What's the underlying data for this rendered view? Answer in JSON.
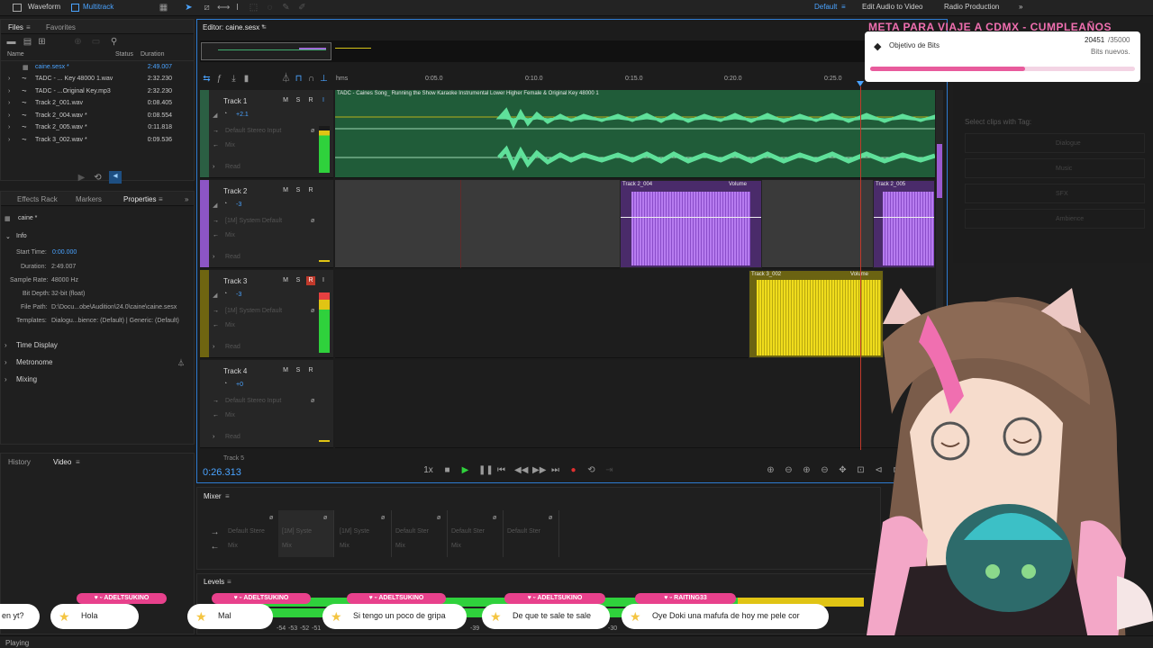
{
  "topbar": {
    "waveform": "Waveform",
    "multitrack": "Multitrack",
    "workspace": "Default",
    "edit_audio_video": "Edit Audio to Video",
    "radio_production": "Radio Production"
  },
  "files_panel": {
    "tabs": [
      "Files",
      "Favorites"
    ],
    "columns": {
      "name": "Name",
      "status": "Status",
      "duration": "Duration"
    },
    "items": [
      {
        "name": "caine.sesx *",
        "duration": "2:49.007"
      },
      {
        "name": "TADC - ... Key 48000 1.wav",
        "duration": "2:32.230"
      },
      {
        "name": "TADC - ...Original Key.mp3",
        "duration": "2:32.230"
      },
      {
        "name": "Track 2_001.wav",
        "duration": "0:08.405"
      },
      {
        "name": "Track 2_004.wav *",
        "duration": "0:08.554"
      },
      {
        "name": "Track 2_005.wav *",
        "duration": "0:11.818"
      },
      {
        "name": "Track 3_002.wav *",
        "duration": "0:09.536"
      }
    ]
  },
  "properties_panel": {
    "tabs": [
      "Effects Rack",
      "Markers",
      "Properties"
    ],
    "file": "caine *",
    "info_label": "Info",
    "start_time_label": "Start Time:",
    "start_time": "0:00.000",
    "duration_label": "Duration:",
    "duration": "2:49.007",
    "sample_rate_label": "Sample Rate:",
    "sample_rate": "48000 Hz",
    "bit_depth_label": "Bit Depth:",
    "bit_depth": "32-bit (float)",
    "file_path_label": "File Path:",
    "file_path": "D:\\Docu...obe\\Audition\\24.0\\caine\\caine.sesx",
    "templates_label": "Templates:",
    "templates": "Dialogu...bience: (Default) | Generic: (Default)",
    "sections": [
      "Time Display",
      "Metronome",
      "Mixing"
    ]
  },
  "history_panel": {
    "tabs": [
      "History",
      "Video"
    ]
  },
  "editor": {
    "title": "Editor: caine.sesx *",
    "ruler": {
      "unit": "hms",
      "ticks": [
        "0:05.0",
        "0:10.0",
        "0:15.0",
        "0:20.0",
        "0:25.0"
      ]
    },
    "time": "0:26.313",
    "speed": "1x",
    "tracks": [
      {
        "name": "Track 1",
        "volume": "+2.1",
        "input": "Default Stereo Input",
        "mix": "Mix",
        "read": "Read"
      },
      {
        "name": "Track 2",
        "volume": "-3",
        "input": "[1M] System Default",
        "mix": "Mix",
        "read": "Read"
      },
      {
        "name": "Track 3",
        "volume": "-3",
        "input": "[1M] System Default",
        "mix": "Mix",
        "read": "Read"
      },
      {
        "name": "Track 4",
        "volume": "+0",
        "input": "Default Stereo Input",
        "mix": "Mix",
        "read": "Read"
      },
      {
        "name": "Track 5"
      }
    ],
    "clips": {
      "track1": "TADC - Caines Song_ Running the Show Karaoke Instrumental Lower Higher Female & Original Key 48000 1",
      "track2a": "Track 2_004",
      "track2b": "Track 2_005",
      "track3": "Track 3_002",
      "volume_tag": "Volume"
    }
  },
  "mixer_panel": {
    "title": "Mixer",
    "inputs": [
      "Default Stere",
      "[1M] Syste",
      "[1M] Syste",
      "Default Ster",
      "Default Ster",
      "Default Ster"
    ],
    "mix": "Mix"
  },
  "levels_panel": {
    "title": "Levels",
    "scale": [
      "-54",
      "-53",
      "-52",
      "-51",
      "-39",
      "-30"
    ]
  },
  "right_panel": {
    "select_clips": "Select clips with Tag:",
    "tags": [
      "Dialogue",
      "Music",
      "SFX",
      "Ambience"
    ]
  },
  "goal_widget": {
    "banner": "META PARA VIAJE A CDMX - CUMPLEAÑOS",
    "label": "Objetivo de Bits",
    "current": "20451",
    "target": "/35000",
    "new_bits": "Bits nuevos.",
    "progress": 0.584
  },
  "chat": [
    {
      "user": "",
      "text": "en yt?"
    },
    {
      "user": "ADELTSUKINO",
      "text": "Hola"
    },
    {
      "user": "ADELTSUKINO",
      "text": "Mal"
    },
    {
      "user": "ADELTSUKINO",
      "text": "Si tengo un poco de gripa"
    },
    {
      "user": "ADELTSUKINO",
      "text": "De que te sale te sale"
    },
    {
      "user": "RAITING33",
      "text": "Oye Doki una mafufa de hoy me pele cor"
    }
  ],
  "status_bar": {
    "text": "Playing"
  },
  "colors": {
    "track1": "#3fae6f",
    "track2": "#a06ad6",
    "track3": "#d4c218",
    "accent": "#4aa3ff",
    "chat_badge": "#e8418c"
  }
}
